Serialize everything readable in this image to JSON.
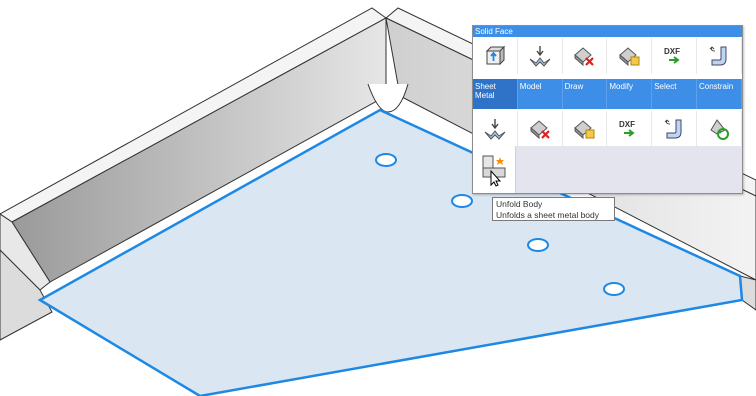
{
  "quad": {
    "header": "Solid Face",
    "row1_icons": [
      "extrude-face-icon",
      "fold-down-icon",
      "delete-face-icon",
      "modify-face-icon",
      "dxf-export-icon",
      "bend-flange-icon"
    ],
    "tabs": [
      "Sheet Metal",
      "Model",
      "Draw",
      "Modify",
      "Select",
      "Constrain"
    ],
    "active_tab": "Sheet Metal",
    "row2_icons": [
      "fold-down-icon",
      "delete-face-icon",
      "modify-face-icon",
      "dxf-export-icon",
      "bend-flange-icon",
      "reset-face-icon"
    ],
    "dxf_label": "DXF",
    "tool": {
      "icon": "unfold-body-icon"
    }
  },
  "tooltip": {
    "title": "Unfold Body",
    "description": "Unfolds a sheet metal body"
  },
  "colors": {
    "accent": "#3d8ee6",
    "selection_edge": "#1e88e5",
    "face_fill": "#dbe6f3"
  }
}
